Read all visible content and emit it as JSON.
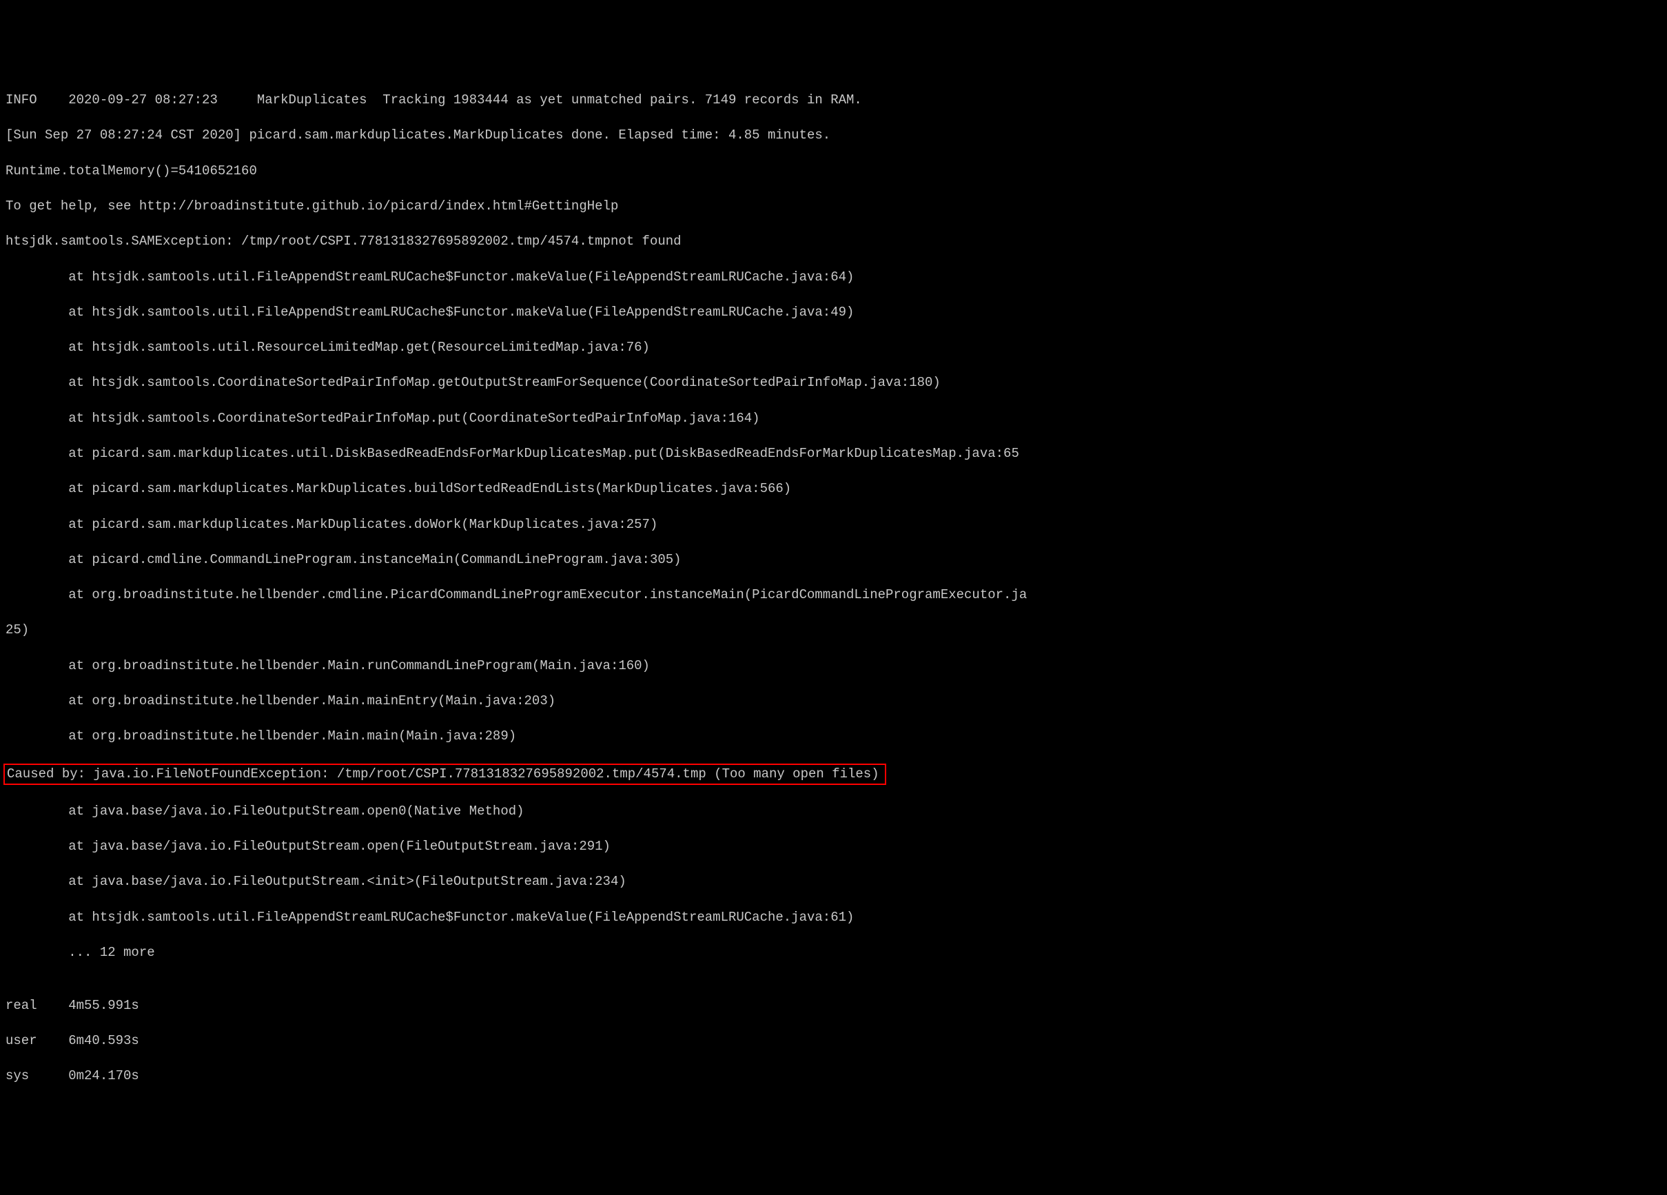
{
  "lines": {
    "l1": "INFO    2020-09-27 08:27:23     MarkDuplicates  Tracking 1983444 as yet unmatched pairs. 7149 records in RAM.",
    "l2": "[Sun Sep 27 08:27:24 CST 2020] picard.sam.markduplicates.MarkDuplicates done. Elapsed time: 4.85 minutes.",
    "l3": "Runtime.totalMemory()=5410652160",
    "l4": "To get help, see http://broadinstitute.github.io/picard/index.html#GettingHelp",
    "l5": "htsjdk.samtools.SAMException: /tmp/root/CSPI.7781318327695892002.tmp/4574.tmpnot found",
    "l6": "        at htsjdk.samtools.util.FileAppendStreamLRUCache$Functor.makeValue(FileAppendStreamLRUCache.java:64)",
    "l7": "        at htsjdk.samtools.util.FileAppendStreamLRUCache$Functor.makeValue(FileAppendStreamLRUCache.java:49)",
    "l8": "        at htsjdk.samtools.util.ResourceLimitedMap.get(ResourceLimitedMap.java:76)",
    "l9": "        at htsjdk.samtools.CoordinateSortedPairInfoMap.getOutputStreamForSequence(CoordinateSortedPairInfoMap.java:180)",
    "l10": "        at htsjdk.samtools.CoordinateSortedPairInfoMap.put(CoordinateSortedPairInfoMap.java:164)",
    "l11": "        at picard.sam.markduplicates.util.DiskBasedReadEndsForMarkDuplicatesMap.put(DiskBasedReadEndsForMarkDuplicatesMap.java:65",
    "l12": "        at picard.sam.markduplicates.MarkDuplicates.buildSortedReadEndLists(MarkDuplicates.java:566)",
    "l13": "        at picard.sam.markduplicates.MarkDuplicates.doWork(MarkDuplicates.java:257)",
    "l14": "        at picard.cmdline.CommandLineProgram.instanceMain(CommandLineProgram.java:305)",
    "l15": "        at org.broadinstitute.hellbender.cmdline.PicardCommandLineProgramExecutor.instanceMain(PicardCommandLineProgramExecutor.ja",
    "l16": "25)",
    "l17": "        at org.broadinstitute.hellbender.Main.runCommandLineProgram(Main.java:160)",
    "l18": "        at org.broadinstitute.hellbender.Main.mainEntry(Main.java:203)",
    "l19": "        at org.broadinstitute.hellbender.Main.main(Main.java:289)",
    "l20": "Caused by: java.io.FileNotFoundException: /tmp/root/CSPI.7781318327695892002.tmp/4574.tmp (Too many open files)",
    "l21": "        at java.base/java.io.FileOutputStream.open0(Native Method)",
    "l22": "        at java.base/java.io.FileOutputStream.open(FileOutputStream.java:291)",
    "l23": "        at java.base/java.io.FileOutputStream.<init>(FileOutputStream.java:234)",
    "l24": "        at htsjdk.samtools.util.FileAppendStreamLRUCache$Functor.makeValue(FileAppendStreamLRUCache.java:61)",
    "l25": "        ... 12 more",
    "l26": "",
    "l27": "real    4m55.991s",
    "l28": "user    6m40.593s",
    "l29": "sys     0m24.170s"
  }
}
